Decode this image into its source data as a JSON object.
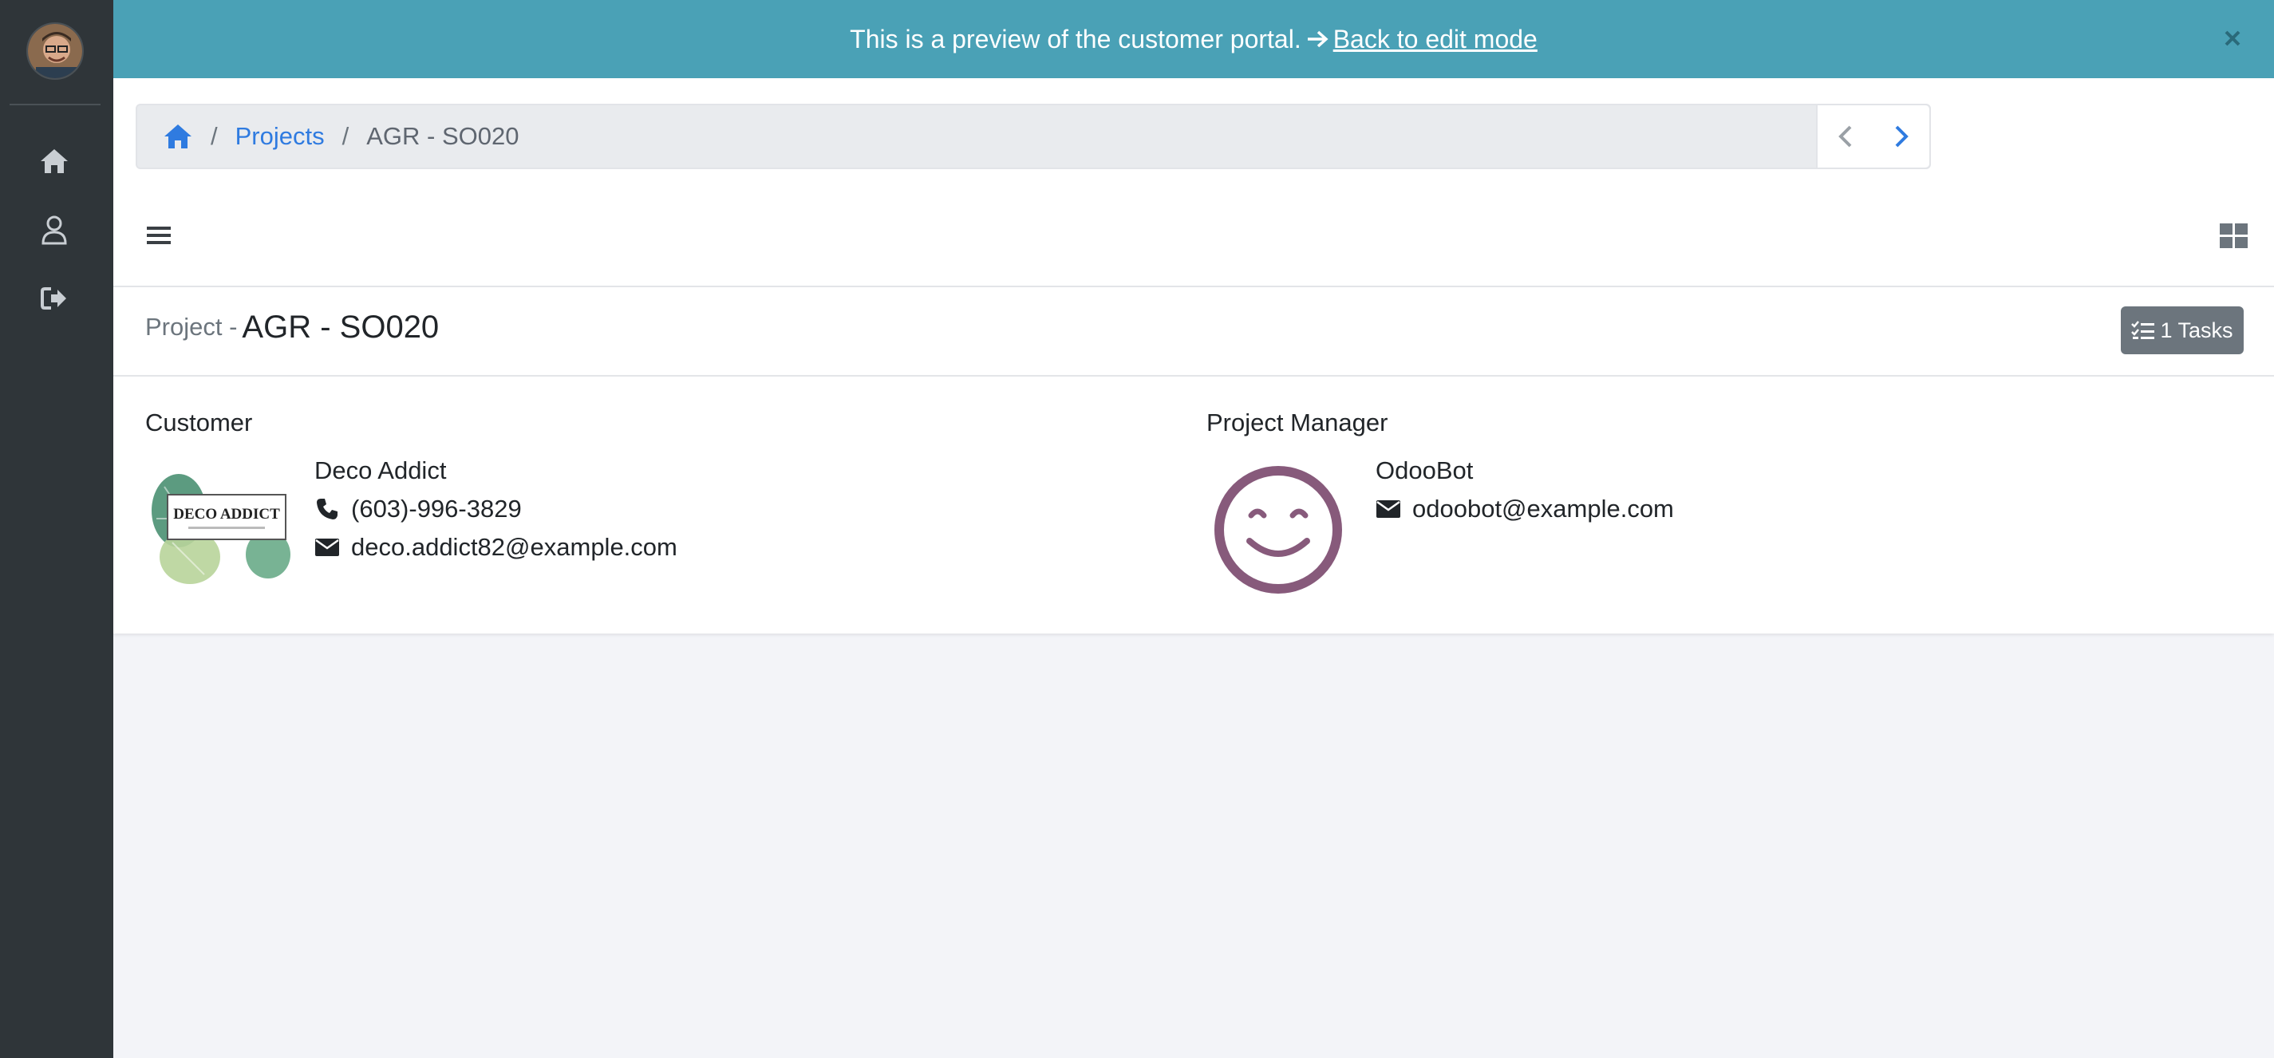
{
  "banner": {
    "message": "This is a preview of the customer portal.",
    "back_link": "Back to edit mode",
    "close_icon": "close-icon",
    "color": "#4aa1b6"
  },
  "sidebar": {
    "items": [
      {
        "icon": "home-icon"
      },
      {
        "icon": "user-icon"
      },
      {
        "icon": "sign-out-icon"
      }
    ]
  },
  "breadcrumb": {
    "home_icon": "home-icon",
    "projects": "Projects",
    "current": "AGR - SO020",
    "separator": "/"
  },
  "project": {
    "prefix": "Project -",
    "name": "AGR - SO020",
    "tasks_button": "1 Tasks"
  },
  "customer": {
    "label": "Customer",
    "name": "Deco Addict",
    "phone": "(603)-996-3829",
    "email": "deco.addict82@example.com",
    "logo_text": "DECO ADDICT"
  },
  "manager": {
    "label": "Project Manager",
    "name": "OdooBot",
    "email": "odoobot@example.com"
  }
}
